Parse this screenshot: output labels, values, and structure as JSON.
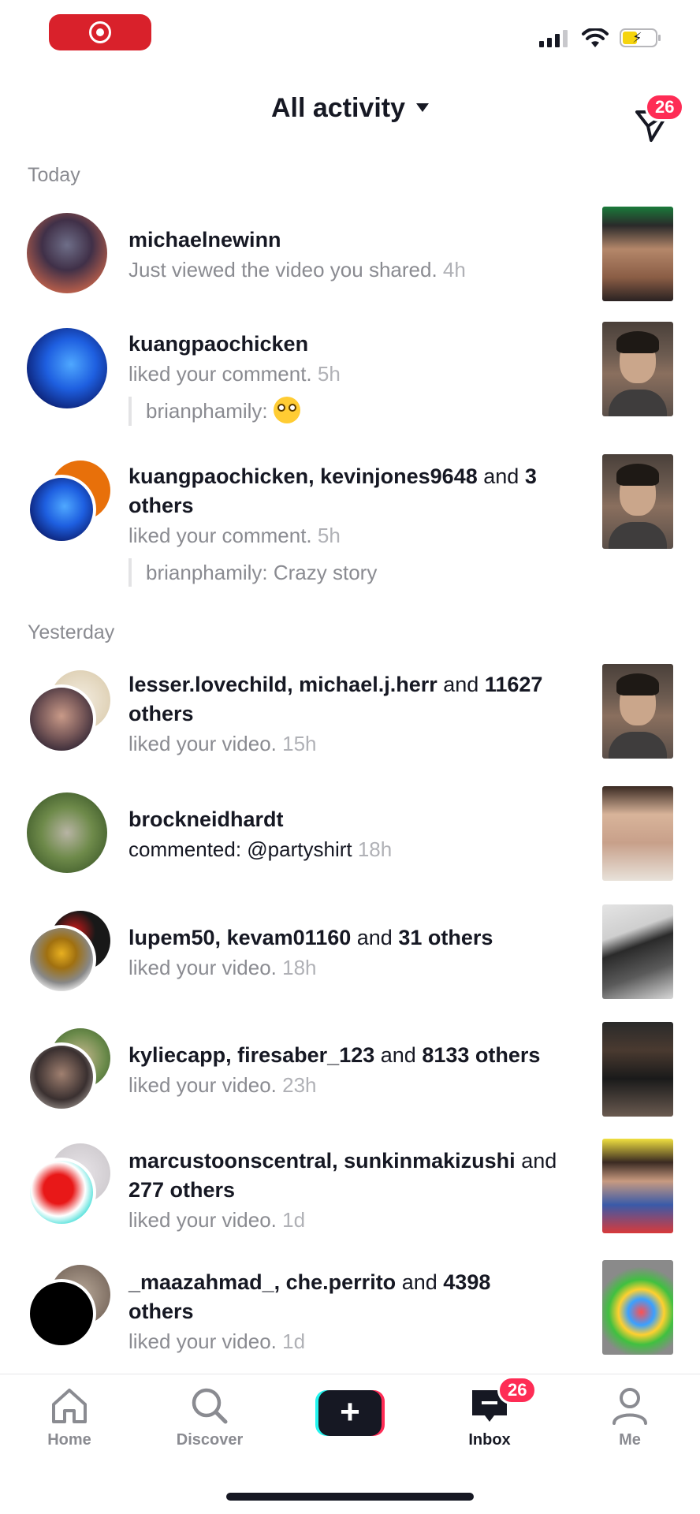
{
  "header": {
    "title": "All activity",
    "badge": "26"
  },
  "sections": {
    "today": "Today",
    "yesterday": "Yesterday"
  },
  "items": [
    {
      "name": "michaelnewinn",
      "action": "Just viewed the video you shared.",
      "time": "4h"
    },
    {
      "name": "kuangpaochicken",
      "action": "liked your comment.",
      "time": "5h",
      "quote_user": "brianphamily:",
      "quote_emoji": "flushed-face-emoji"
    },
    {
      "name1": "kuangpaochicken",
      "sep": ",",
      "name2": "kevinjones9648",
      "and": "and",
      "count": "3",
      "line2": "others",
      "action": "liked your comment.",
      "time": "5h",
      "quote": "brianphamily: Crazy story"
    },
    {
      "name1": "lesser.lovechild",
      "sep": ",",
      "name2": "michael.j.herr",
      "and": "and",
      "count": "11627",
      "line2": "others",
      "action": "liked your video.",
      "time": "15h"
    },
    {
      "name": "brockneidhardt",
      "action": "commented: @partyshirt",
      "time": "18h"
    },
    {
      "name1": "lupem50",
      "sep": ",",
      "name2": "kevam01160",
      "and": "and",
      "count": "31 others",
      "action": "liked your video.",
      "time": "18h"
    },
    {
      "name1": "kyliecapp",
      "sep": ",",
      "name2": "firesaber_123",
      "and": "and",
      "count": "8133 others",
      "action": "liked your video.",
      "time": "23h"
    },
    {
      "name1": "marcustoonscentral",
      "sep": ",",
      "name2": "sunkinmakizushi",
      "and": "and",
      "line2": "277 others",
      "action": "liked your video.",
      "time": "1d"
    },
    {
      "name1": "_maazahmad_",
      "sep": ",",
      "name2": "che.perrito",
      "and": "and",
      "count": "4398",
      "line2": "others",
      "action": "liked your video.",
      "time": "1d"
    }
  ],
  "nav": {
    "home": "Home",
    "discover": "Discover",
    "inbox": "Inbox",
    "inbox_badge": "26",
    "me": "Me"
  },
  "colors": {
    "accent": "#fe2c55",
    "cyan": "#25f4ee",
    "text": "#161823",
    "secondary": "#8a8b91"
  }
}
